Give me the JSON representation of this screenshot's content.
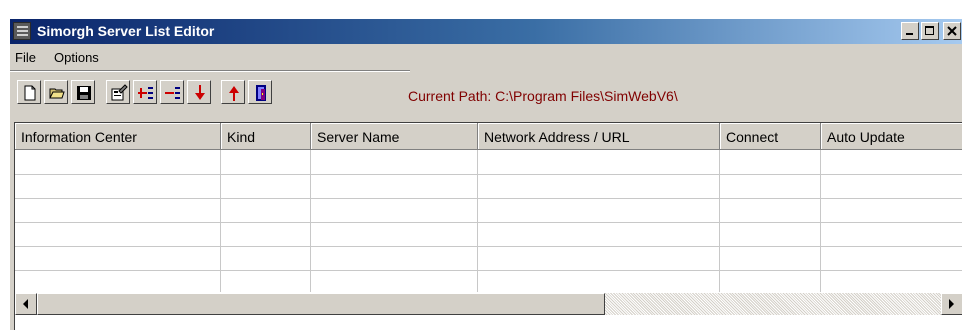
{
  "window": {
    "title": "Simorgh Server List Editor",
    "title_colors": [
      "#0a246a",
      "#a6caf0"
    ]
  },
  "menu": {
    "items": [
      {
        "label": "File"
      },
      {
        "label": "Options"
      }
    ]
  },
  "toolbar": {
    "buttons": [
      {
        "icon": "new-file-icon"
      },
      {
        "icon": "open-folder-icon"
      },
      {
        "icon": "save-disk-icon"
      },
      {
        "icon": "properties-icon"
      },
      {
        "icon": "insert-row-icon"
      },
      {
        "icon": "delete-row-icon"
      },
      {
        "icon": "move-down-arrow-icon"
      },
      {
        "icon": "move-up-arrow-icon"
      },
      {
        "icon": "exit-door-icon"
      }
    ]
  },
  "path": {
    "text": "Current Path: C:\\Program Files\\SimWebV6\\",
    "color": "#800000"
  },
  "table": {
    "columns": [
      "Information Center",
      "Kind",
      "Server Name",
      "Network Address / URL",
      "Connect",
      "Auto Update"
    ],
    "rows": []
  }
}
